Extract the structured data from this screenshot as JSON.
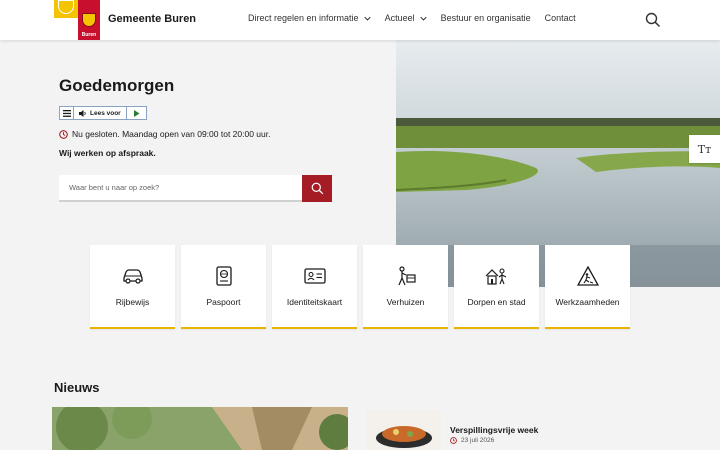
{
  "header": {
    "site_name": "Gemeente Buren",
    "logo_text": "Buren",
    "nav": [
      {
        "label": "Direct regelen en informatie",
        "has_dropdown": true
      },
      {
        "label": "Actueel",
        "has_dropdown": true
      },
      {
        "label": "Bestuur en organisatie",
        "has_dropdown": false
      },
      {
        "label": "Contact",
        "has_dropdown": false
      }
    ],
    "search_icon": "search-icon"
  },
  "hero": {
    "greeting": "Goedemorgen",
    "readspeaker_label": "Lees voor",
    "opening_hours": "Nu gesloten. Maandag open van 09:00 tot 20:00 uur.",
    "appointment_note": "Wij werken op afspraak.",
    "search_placeholder": "Waar bent u naar op zoek?",
    "text_size_label": "Tт"
  },
  "tiles": [
    {
      "label": "Rijbewijs",
      "icon": "car-icon"
    },
    {
      "label": "Paspoort",
      "icon": "passport-icon"
    },
    {
      "label": "Identiteitskaart",
      "icon": "id-card-icon"
    },
    {
      "label": "Verhuizen",
      "icon": "moving-icon"
    },
    {
      "label": "Dorpen en stad",
      "icon": "village-icon"
    },
    {
      "label": "Werkzaamheden",
      "icon": "roadwork-icon"
    }
  ],
  "news": {
    "heading": "Nieuws",
    "items": [
      {
        "title": "Verspillingsvrije week",
        "date": "23 juli 2026"
      }
    ]
  },
  "colors": {
    "accent_red": "#a51c24",
    "tile_underline": "#e8b400",
    "background": "#f3f3f3"
  }
}
